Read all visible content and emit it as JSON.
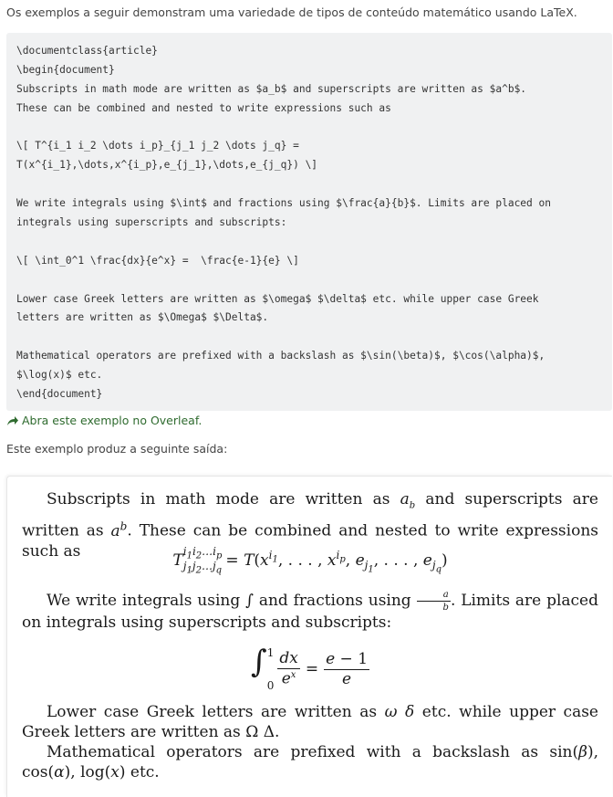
{
  "intro": "Os exemplos a seguir demonstram uma variedade de tipos de conteúdo matemático usando LaTeX.",
  "code_lines": [
    "\\documentclass{article}",
    "\\begin{document}",
    "Subscripts in math mode are written as $a_b$ and superscripts are written as $a^b$.",
    "These can be combined and nested to write expressions such as",
    "",
    "\\[ T^{i_1 i_2 \\dots i_p}_{j_1 j_2 \\dots j_q} =",
    "T(x^{i_1},\\dots,x^{i_p},e_{j_1},\\dots,e_{j_q}) \\]",
    "",
    "We write integrals using $\\int$ and fractions using $\\frac{a}{b}$. Limits are placed on",
    "integrals using superscripts and subscripts:",
    "",
    "\\[ \\int_0^1 \\frac{dx}{e^x} =  \\frac{e-1}{e} \\]",
    "",
    "Lower case Greek letters are written as $\\omega$ $\\delta$ etc. while upper case Greek",
    "letters are written as $\\Omega$ $\\Delta$.",
    "",
    "Mathematical operators are prefixed with a backslash as $\\sin(\\beta)$, $\\cos(\\alpha)$,",
    "$\\log(x)$ etc.",
    "\\end{document}"
  ],
  "overleaf_link": "Abra este exemplo no Overleaf.",
  "output_label": "Este exemplo produz a seguinte saída:",
  "output": {
    "p1a": "Subscripts in math mode are written as ",
    "p1b": " and superscripts are written as",
    "p1c": ". These can be combined and nested to write expressions such as",
    "p2a": "We write integrals using ",
    "p2b": " and fractions using ",
    "p2c": ".  Limits are placed on integrals using superscripts and subscripts:",
    "p3a": "Lower case Greek letters are written as ",
    "p3b": " etc.  while upper case Greek letters are written as ",
    "p3c": ".",
    "p4a": "Mathematical operators are prefixed with a backslash as ",
    "p4b": ", ",
    "p4c": ", ",
    "p4d": " etc."
  }
}
